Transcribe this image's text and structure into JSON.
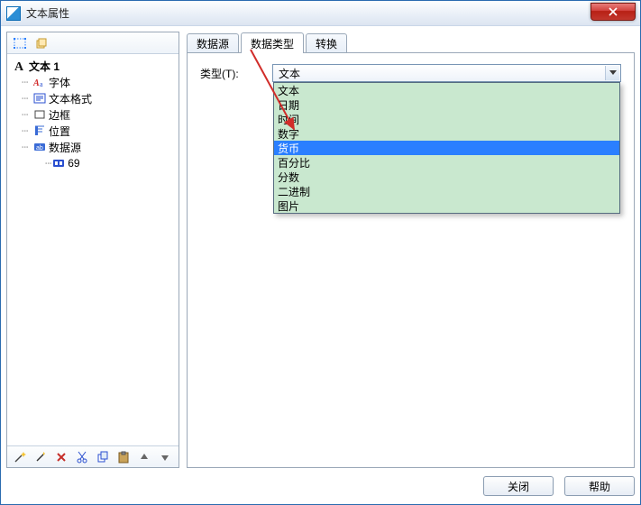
{
  "window": {
    "title": "文本属性"
  },
  "tree": {
    "root": "文本 1",
    "children": [
      {
        "label": "字体"
      },
      {
        "label": "文本格式"
      },
      {
        "label": "边框"
      },
      {
        "label": "位置"
      },
      {
        "label": "数据源"
      }
    ],
    "datasource_child": "69"
  },
  "tabs": {
    "items": [
      {
        "label": "数据源"
      },
      {
        "label": "数据类型"
      },
      {
        "label": "转换"
      }
    ],
    "active_index": 1
  },
  "form": {
    "type_label": "类型(T):",
    "selected_value": "文本",
    "options": [
      "文本",
      "日期",
      "时间",
      "数字",
      "货币",
      "百分比",
      "分数",
      "二进制",
      "图片"
    ],
    "highlight_index": 4
  },
  "footer": {
    "close_label": "关闭",
    "help_label": "帮助"
  }
}
